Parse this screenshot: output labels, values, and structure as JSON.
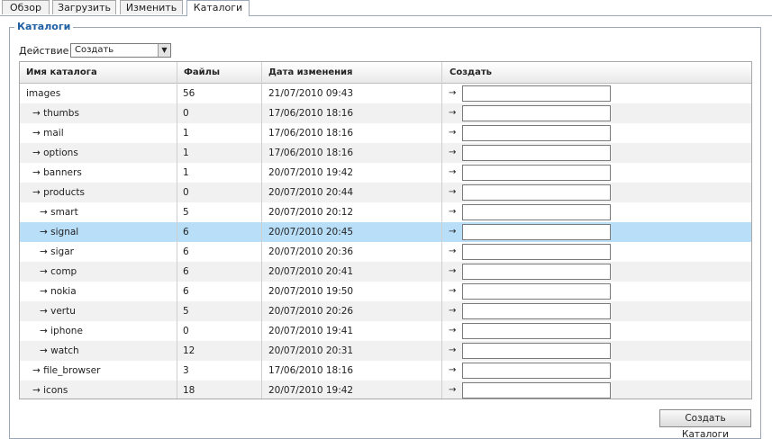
{
  "tabs": [
    {
      "label": "Обзор",
      "active": false
    },
    {
      "label": "Загрузить",
      "active": false
    },
    {
      "label": "Изменить",
      "active": false
    },
    {
      "label": "Каталоги",
      "active": true
    }
  ],
  "section": {
    "legend": "Каталоги"
  },
  "action": {
    "label": "Действие",
    "selected": "Создать"
  },
  "table": {
    "headers": {
      "name": "Имя каталога",
      "files": "Файлы",
      "date": "Дата изменения",
      "create": "Создать"
    },
    "arrow": "→",
    "rows": [
      {
        "name": "images",
        "files": "56",
        "date": "21/07/2010 09:43",
        "depth": 0
      },
      {
        "name": "→ thumbs",
        "files": "0",
        "date": "17/06/2010 18:16",
        "depth": 1
      },
      {
        "name": "→ mail",
        "files": "1",
        "date": "17/06/2010 18:16",
        "depth": 1
      },
      {
        "name": "→ options",
        "files": "1",
        "date": "17/06/2010 18:16",
        "depth": 1
      },
      {
        "name": "→ banners",
        "files": "1",
        "date": "20/07/2010 19:42",
        "depth": 1
      },
      {
        "name": "→ products",
        "files": "0",
        "date": "20/07/2010 20:44",
        "depth": 1
      },
      {
        "name": "→ smart",
        "files": "5",
        "date": "20/07/2010 20:12",
        "depth": 2
      },
      {
        "name": "→ signal",
        "files": "6",
        "date": "20/07/2010 20:45",
        "depth": 2,
        "selected": true
      },
      {
        "name": "→ sigar",
        "files": "6",
        "date": "20/07/2010 20:36",
        "depth": 2
      },
      {
        "name": "→ comp",
        "files": "6",
        "date": "20/07/2010 20:41",
        "depth": 2
      },
      {
        "name": "→ nokia",
        "files": "6",
        "date": "20/07/2010 19:50",
        "depth": 2
      },
      {
        "name": "→ vertu",
        "files": "5",
        "date": "20/07/2010 20:26",
        "depth": 2
      },
      {
        "name": "→ iphone",
        "files": "0",
        "date": "20/07/2010 19:41",
        "depth": 2
      },
      {
        "name": "→ watch",
        "files": "12",
        "date": "20/07/2010 20:31",
        "depth": 2
      },
      {
        "name": "→ file_browser",
        "files": "3",
        "date": "17/06/2010 18:16",
        "depth": 1
      },
      {
        "name": "→ icons",
        "files": "18",
        "date": "20/07/2010 19:42",
        "depth": 1
      }
    ]
  },
  "buttons": {
    "create_label": "Создать Каталоги"
  },
  "colors": {
    "selected_row": "#b9def8",
    "legend": "#1f5fa3",
    "alt_row": "#f1f1f1"
  }
}
